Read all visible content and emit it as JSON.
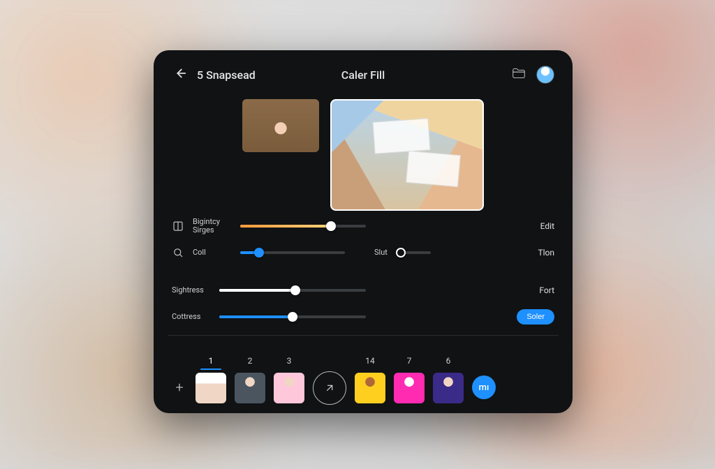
{
  "header": {
    "back_title": "5 Snapsead",
    "center_title": "Caler Fill"
  },
  "sliders": {
    "brightness": {
      "label": "Bigintcy Sirges",
      "right": "Edit",
      "pct": 72,
      "fill_color": "linear-gradient(90deg,#ff9a3c,#ffd27a)"
    },
    "col": {
      "label": "Coll",
      "pct": 18,
      "fill_color": "#1e90ff"
    },
    "slut": {
      "label": "Slut",
      "right": "Tlon",
      "pct": 5
    },
    "sightress": {
      "label": "Sightress",
      "right": "Fort",
      "pct": 52,
      "fill_color": "#ffffff"
    },
    "contrast": {
      "label": "Cottress",
      "pct": 50,
      "fill_color": "#1e90ff"
    }
  },
  "save_button": "Soler",
  "strip": {
    "items": [
      {
        "num": "1",
        "cls": "t1",
        "active": true
      },
      {
        "num": "2",
        "cls": "t2",
        "active": false
      },
      {
        "num": "3",
        "cls": "t3",
        "active": false
      },
      {
        "num": "14",
        "cls": "t14",
        "active": false
      },
      {
        "num": "7",
        "cls": "t7",
        "active": false
      },
      {
        "num": "6",
        "cls": "t6",
        "active": false
      }
    ],
    "mi_label": "mı"
  }
}
